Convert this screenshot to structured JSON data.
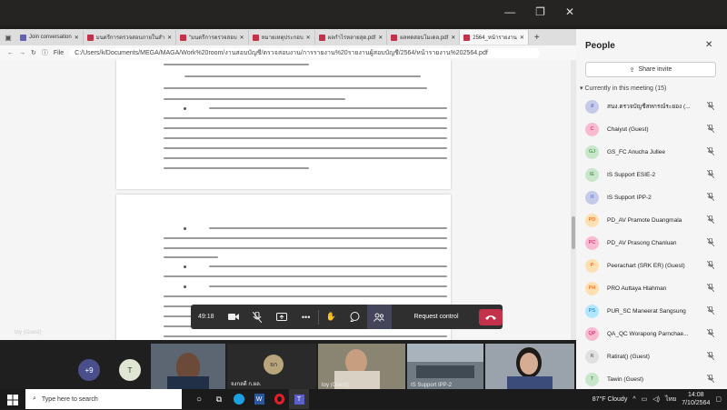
{
  "window": {
    "minimize": "—",
    "restore": "❐",
    "close": "✕"
  },
  "browser": {
    "tabs": [
      {
        "label": "Join conversation",
        "color": "#6264a7"
      },
      {
        "label": "มนตรีการตรวจสอบภายในสำ",
        "color": "#c4314b"
      },
      {
        "label": "“มนตรีการตรวจสอบ",
        "color": "#c4314b"
      },
      {
        "label": "หมายเหตุประกอบ",
        "color": "#c4314b"
      },
      {
        "label": "ผลกำไรหลายสุด.pdf",
        "color": "#c4314b"
      },
      {
        "label": "ผลทดสอบโมเดล.pdf",
        "color": "#c4314b"
      },
      {
        "label": "2564_หน้ารายงาน",
        "color": "#c4314b"
      }
    ],
    "new_tab": "+",
    "file_label": "File",
    "url": "C:/Users/k/Documents/MEGA/MAGA/Work%20room/งานสอบบัญชี/ตรวจสอบงาน/การรายงาน%20รายงานผู้สอบบัญชี/2564/หน้ารายงาน%202564.pdf"
  },
  "people": {
    "title": "People",
    "share_invite": "Share invite",
    "meeting_header": "Currently in this meeting (15)",
    "participants": [
      {
        "initials": "ส",
        "name": "สนง.ตรวจบัญชีสหกรณ์ระยอง (...",
        "bg": "#c5cae9",
        "fg": "#3f51b5"
      },
      {
        "initials": "C",
        "name": "Chaiyut (Guest)",
        "bg": "#f8bbd0",
        "fg": "#c2185b"
      },
      {
        "initials": "GJ",
        "name": "GS_FC Anucha Jullee",
        "bg": "#c8e6c9",
        "fg": "#2e7d32"
      },
      {
        "initials": "IE",
        "name": "IS Support ESIE-2",
        "bg": "#c8e6c9",
        "fg": "#2e7d32"
      },
      {
        "initials": "II",
        "name": "IS Support IPP-2",
        "bg": "#c5cae9",
        "fg": "#3f51b5"
      },
      {
        "initials": "PD",
        "name": "PD_AV Pramote Duangmala",
        "bg": "#ffe0b2",
        "fg": "#e65100"
      },
      {
        "initials": "PC",
        "name": "PD_AV Prasong Chanluan",
        "bg": "#f8bbd0",
        "fg": "#c2185b"
      },
      {
        "initials": "P",
        "name": "Peerachart (SRK ER) (Guest)",
        "bg": "#ffe0b2",
        "fg": "#e65100"
      },
      {
        "initials": "PH",
        "name": "PRO Auttaya Hlahman",
        "bg": "#ffe0b2",
        "fg": "#e65100"
      },
      {
        "initials": "PS",
        "name": "PUR_SC Maneerat Sangsung",
        "bg": "#b3e5fc",
        "fg": "#0277bd"
      },
      {
        "initials": "QP",
        "name": "QA_QC Worapong Parnchae...",
        "bg": "#f8bbd0",
        "fg": "#c2185b"
      },
      {
        "initials": "R",
        "name": "Ratirat() (Guest)",
        "bg": "#e0e0e0",
        "fg": "#555555"
      },
      {
        "initials": "T",
        "name": "Tawin (Guest)",
        "bg": "#c8e6c9",
        "fg": "#2e7d32"
      }
    ]
  },
  "toolbar": {
    "timer": "49:18",
    "request_control": "Request control"
  },
  "video": {
    "overflow_count": "+9",
    "guest_label": "toy (Guest)",
    "tiles": [
      {
        "initials": "T",
        "label": ""
      },
      {
        "initials": "",
        "label": ""
      },
      {
        "initials": "จก",
        "label": "จงกลดี ก.ผล."
      },
      {
        "initials": "",
        "label": "toy (Guest)"
      },
      {
        "initials": "",
        "label": "IS Support IPP-2"
      },
      {
        "initials": "",
        "label": ""
      }
    ]
  },
  "taskbar": {
    "search_placeholder": "Type here to search",
    "weather": "87°F  Cloudy",
    "lang": "ไทย",
    "time": "14:08",
    "date": "7/10/2564"
  }
}
